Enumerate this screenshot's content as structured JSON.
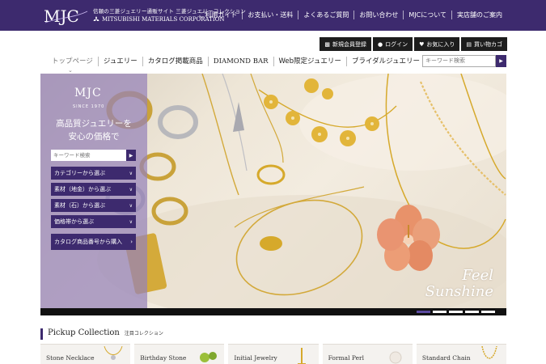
{
  "header": {
    "logo_text": "MJC",
    "tagline": "信頼の三菱ジュエリー通販サイト 三菱ジュエリーコレクション",
    "corporation": "MITSUBISHI MATERIALS CORPORATION",
    "links": [
      "ご利用ガイド",
      "お支払い・送料",
      "よくあるご質問",
      "お問い合わせ",
      "MJCについて",
      "実店舗のご案内"
    ]
  },
  "member_buttons": [
    {
      "icon": "register-icon",
      "label": "新規会員登録"
    },
    {
      "icon": "user-icon",
      "label": "ログイン"
    },
    {
      "icon": "heart-icon",
      "label": "お気に入り"
    },
    {
      "icon": "cart-icon",
      "label": "買い物カゴ"
    }
  ],
  "main_nav": [
    "トップページ",
    "ジュエリー",
    "カタログ掲載商品",
    "DIAMOND BAR",
    "Web限定ジュエリー",
    "ブライダルジュエリー"
  ],
  "top_search": {
    "placeholder": "キーワード検索"
  },
  "hero": {
    "panel_logo": "MJC",
    "since": "SINCE 1970",
    "catch_line1": "高品質ジュエリーを",
    "catch_line2": "安心の価格で",
    "search_placeholder": "キーワード検索",
    "menu": [
      "カテゴリーから選ぶ",
      "素材（地金）から選ぶ",
      "素材（石）から選ぶ",
      "価格帯から選ぶ"
    ],
    "catalog_button": "カタログ商品番号から購入",
    "feel_line1": "Feel",
    "feel_line2": "Sunshine",
    "slides_total": 5,
    "slide_active": 1
  },
  "pickup": {
    "title": "Pickup Collection",
    "subtitle": "注目コレクション",
    "cards": [
      "Stone Necklace",
      "Birthday Stone",
      "Initial Jewelry",
      "Formal Perl",
      "Standard Chain"
    ]
  },
  "colors": {
    "brand_purple": "#3d2a6e",
    "panel_lilac": "#9682b9",
    "gold": "#d6a92b"
  }
}
